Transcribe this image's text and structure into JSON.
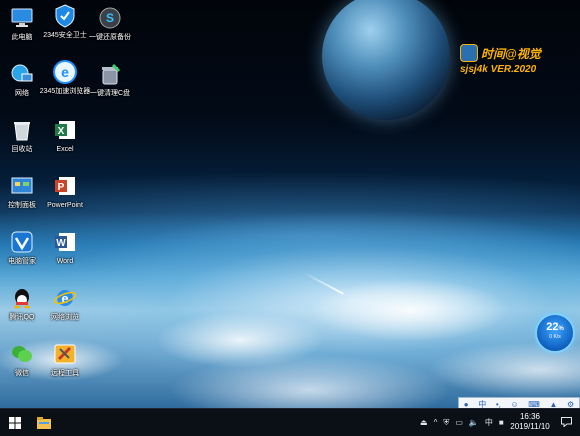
{
  "desktop": {
    "icons": [
      {
        "label": "此电脑",
        "icon": "computer-icon"
      },
      {
        "label": "2345安全卫士",
        "icon": "shield-icon"
      },
      {
        "label": "一键还原备份",
        "icon": "restore-icon"
      },
      {
        "label": "网络",
        "icon": "network-icon"
      },
      {
        "label": "2345加速浏览器",
        "icon": "browser-icon"
      },
      {
        "label": "一键清理C盘",
        "icon": "cleanup-icon"
      },
      {
        "label": "回收站",
        "icon": "recycle-bin-icon"
      },
      {
        "label": "Excel",
        "icon": "excel-icon"
      },
      {
        "label": "控制面板",
        "icon": "control-panel-icon"
      },
      {
        "label": "PowerPoint",
        "icon": "powerpoint-icon"
      },
      {
        "label": "电脑管家",
        "icon": "pc-manager-icon"
      },
      {
        "label": "Word",
        "icon": "word-icon"
      },
      {
        "label": "腾讯QQ",
        "icon": "qq-icon"
      },
      {
        "label": "网络浏览",
        "icon": "ie-icon"
      },
      {
        "label": "微信",
        "icon": "wechat-icon"
      },
      {
        "label": "远程工具",
        "icon": "tools-icon"
      }
    ]
  },
  "watermark": {
    "title": "时间@视觉",
    "subtitle": "sjsj4k VER.2020"
  },
  "speed_ball": {
    "value": "22",
    "unit": "%",
    "net": "0 K/s"
  },
  "langbar": {
    "items": [
      "中",
      "•,",
      "☺",
      "⌨",
      "中",
      "⚙"
    ]
  },
  "taskbar": {
    "start_icon": "windows-logo-icon",
    "pinned": [
      "file-explorer-icon"
    ],
    "tray": [
      "^",
      "中"
    ],
    "time": "16:36",
    "date": "2019/11/10"
  },
  "colors": {
    "taskbar": "#0b0f16",
    "accent": "#2a62b8",
    "watermark": "#ffb300"
  }
}
